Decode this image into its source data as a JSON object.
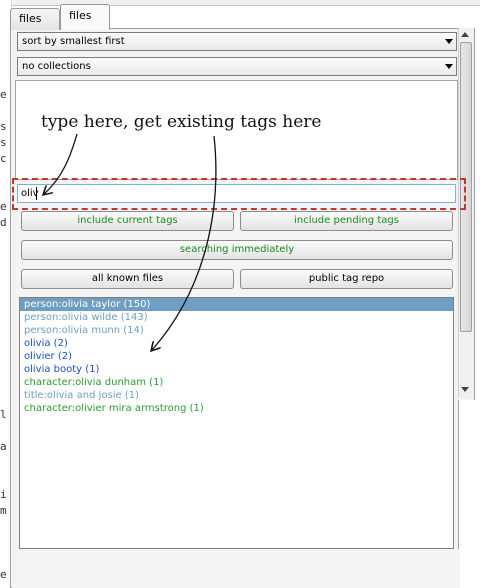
{
  "tabs": [
    {
      "label": "files"
    },
    {
      "label": "files"
    }
  ],
  "dropdowns": {
    "sort": {
      "value": "sort by smallest first"
    },
    "collections": {
      "value": "no collections"
    }
  },
  "annotation": {
    "text": "type here, get existing tags here"
  },
  "search": {
    "value": "oliv"
  },
  "buttons": {
    "include_current": "include current tags",
    "include_pending": "include pending tags",
    "searching": "searching immediately",
    "file_domain": "all known files",
    "tag_service": "public tag repo"
  },
  "results": [
    {
      "text": "person:olivia taylor (150)",
      "color": "#ffffff",
      "selected": true
    },
    {
      "text": "person:olivia wilde (143)",
      "color": "#6f9ec2",
      "selected": false
    },
    {
      "text": "person:olivia munn (14)",
      "color": "#6f9ec2",
      "selected": false
    },
    {
      "text": "olivia (2)",
      "color": "#1f4fc4",
      "selected": false
    },
    {
      "text": "olivier (2)",
      "color": "#1f4fc4",
      "selected": false
    },
    {
      "text": "olivia booty (1)",
      "color": "#1f4fc4",
      "selected": false
    },
    {
      "text": "character:olivia dunham (1)",
      "color": "#2e9a2e",
      "selected": false
    },
    {
      "text": "title:olivia and josie (1)",
      "color": "#6f9ec2",
      "selected": false
    },
    {
      "text": "character:olivier mira armstrong (1)",
      "color": "#2e9a2e",
      "selected": false
    }
  ],
  "edge_glyphs": [
    "e",
    "s",
    "s",
    "c",
    "e",
    "d",
    "l",
    "a",
    "i",
    "m",
    "e"
  ],
  "colors": {
    "highlight": "#c0392b",
    "green_text": "#1f8a1f",
    "selected_row": "#6f9ec2"
  },
  "icons": {
    "dropdown_arrow": "chevron-down-icon",
    "scroll_up": "triangle-up-icon",
    "scroll_down": "triangle-down-icon"
  }
}
